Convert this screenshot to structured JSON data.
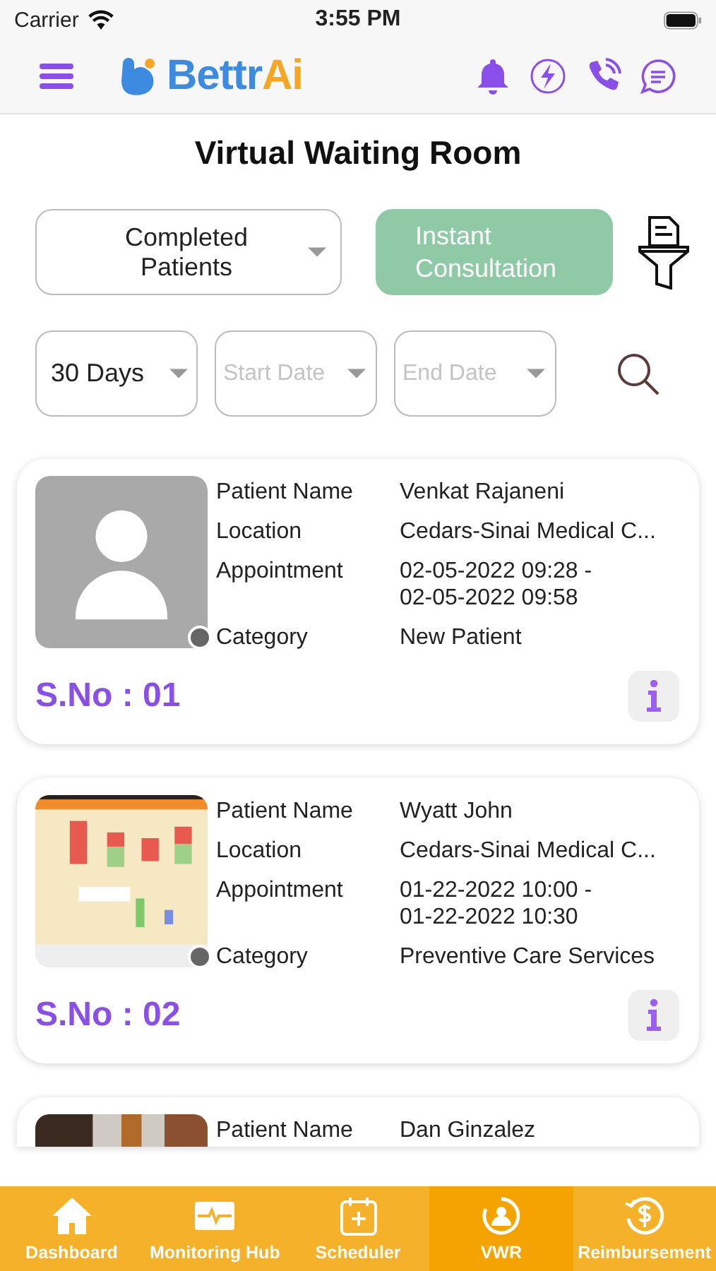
{
  "status_bar": {
    "carrier": "Carrier",
    "time": "3:55 PM"
  },
  "header": {
    "logo_text": "Bettr",
    "logo_accent": "Ai"
  },
  "title": "Virtual Waiting Room",
  "filters": {
    "patient_type": "Completed Patients",
    "instant_button": "Instant Consultation",
    "range": "30 Days",
    "start_placeholder": "Start Date",
    "end_placeholder": "End Date"
  },
  "patients": [
    {
      "kind": "avatar",
      "color": "#666666",
      "fields": [
        {
          "label": "Patient Name",
          "value": "Venkat Rajaneni"
        },
        {
          "label": "Location",
          "value": "Cedars-Sinai Medical C..."
        },
        {
          "label": "Appointment",
          "value": "02-05-2022 09:28 -\n02-05-2022 09:58"
        },
        {
          "label": "Category",
          "value": "New Patient"
        }
      ],
      "serial": "S.No : 01"
    },
    {
      "kind": "picture",
      "color": "#666666",
      "fields": [
        {
          "label": "Patient Name",
          "value": "Wyatt John"
        },
        {
          "label": "Location",
          "value": "Cedars-Sinai Medical C..."
        },
        {
          "label": "Appointment",
          "value": "01-22-2022 10:00 -\n01-22-2022 10:30"
        },
        {
          "label": "Category",
          "value": "Preventive Care Services"
        }
      ],
      "serial": "S.No : 02"
    },
    {
      "kind": "picture",
      "fields": [
        {
          "label": "Patient Name",
          "value": "Dan Ginzalez"
        }
      ]
    }
  ],
  "tabs": [
    {
      "label": "Dashboard",
      "selected": false
    },
    {
      "label": "Monitoring Hub",
      "selected": false
    },
    {
      "label": "Scheduler",
      "selected": false
    },
    {
      "label": "VWR",
      "selected": true
    },
    {
      "label": "Reimbursement",
      "selected": false
    }
  ]
}
